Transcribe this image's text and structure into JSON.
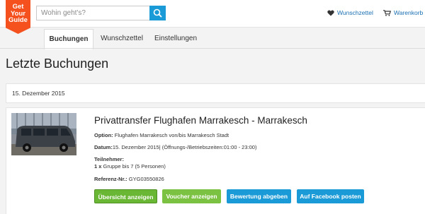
{
  "logo": {
    "line1": "Get",
    "line2": "Your",
    "line3": "Guide"
  },
  "search": {
    "placeholder": "Wohin geht's?",
    "icon": "search-icon"
  },
  "header": {
    "wishlist_label": "Wunschzettel",
    "cart_label": "Warenkorb",
    "wishlist_icon": "heart-icon",
    "cart_icon": "cart-icon"
  },
  "tabs": [
    {
      "label": "Buchungen",
      "active": true
    },
    {
      "label": "Wunschzettel",
      "active": false
    },
    {
      "label": "Einstellungen",
      "active": false
    }
  ],
  "page_title": "Letzte Buchungen",
  "date_group": "15. Dezember 2015",
  "booking": {
    "title": "Privattransfer Flughafen Marrakesch - Marrakesch",
    "option_label": "Option:",
    "option_value": "Flughafen Marrakesch von/bis Marrakesch Stadt",
    "date_label": "Datum:",
    "date_value": "15. Dezember 2015| (Öffnungs-/Betriebszeiten:01:00 - 23:00)",
    "participants_label": "Teilnehmer:",
    "participants_count": "1 x",
    "participants_value": "Gruppe bis 7 (5 Personen)",
    "reference_label": "Referenz-Nr.:",
    "reference_value": "GYG03550826",
    "image_alt": "van-photo"
  },
  "buttons": {
    "overview": "Übersicht anzeigen",
    "voucher": "Voucher anzeigen",
    "review": "Bewertung abgeben",
    "facebook": "Auf Facebook posten"
  },
  "colors": {
    "brand_orange": "#f4511e",
    "accent_blue": "#1a9ad6",
    "accent_green": "#7cc242"
  }
}
